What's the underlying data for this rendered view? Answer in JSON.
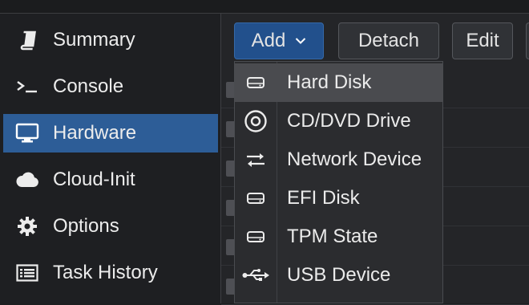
{
  "sidebar": {
    "items": [
      {
        "label": "Summary",
        "icon": "book-icon"
      },
      {
        "label": "Console",
        "icon": "terminal-icon"
      },
      {
        "label": "Hardware",
        "icon": "monitor-icon",
        "active": true
      },
      {
        "label": "Cloud-Init",
        "icon": "cloud-icon"
      },
      {
        "label": "Options",
        "icon": "gear-icon"
      },
      {
        "label": "Task History",
        "icon": "list-icon"
      }
    ]
  },
  "toolbar": {
    "add_label": "Add",
    "detach_label": "Detach",
    "edit_label": "Edit"
  },
  "add_menu": {
    "items": [
      {
        "label": "Hard Disk",
        "icon": "hard-disk-icon",
        "highlighted": true
      },
      {
        "label": "CD/DVD Drive",
        "icon": "cd-dvd-icon"
      },
      {
        "label": "Network Device",
        "icon": "network-exchange-icon"
      },
      {
        "label": "EFI Disk",
        "icon": "hard-disk-icon"
      },
      {
        "label": "TPM State",
        "icon": "hard-disk-icon"
      },
      {
        "label": "USB Device",
        "icon": "usb-icon"
      }
    ]
  },
  "colors": {
    "accent": "#2d5d97",
    "add_button": "#22508c",
    "background": "#1d1e20"
  }
}
